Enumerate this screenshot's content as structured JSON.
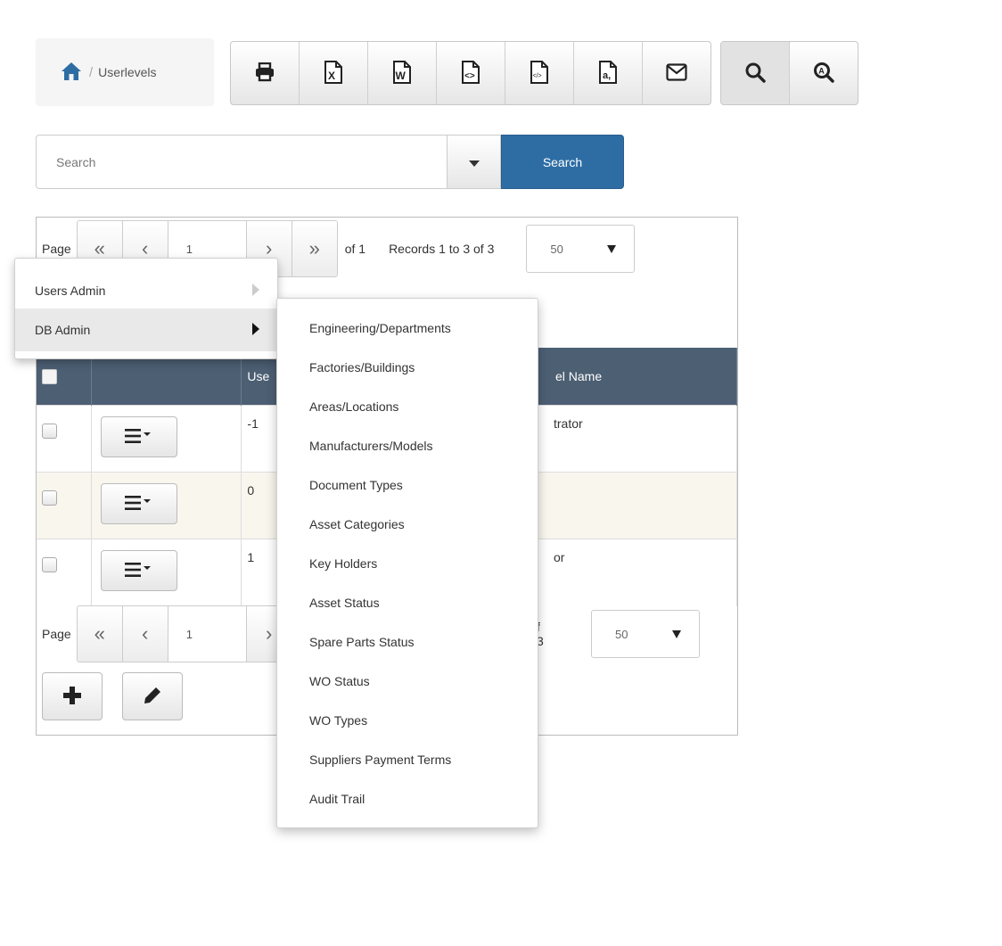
{
  "breadcrumb": {
    "current": "Userlevels",
    "separator": "/"
  },
  "toolbar": {
    "export_icons": [
      "printer-icon",
      "excel-icon",
      "word-icon",
      "html-icon",
      "xml-icon",
      "csv-icon",
      "email-icon"
    ],
    "search_icons": [
      "search-icon",
      "advanced-search-icon"
    ]
  },
  "search": {
    "placeholder": "Search",
    "button_label": "Search"
  },
  "pager_top": {
    "label": "Page",
    "current_page": "1",
    "of_text": "of 1",
    "records_text": "Records 1 to 3 of 3",
    "page_size": "50"
  },
  "pager_bottom": {
    "label": "Page",
    "current_page": "1",
    "records_fragment": "f 3",
    "page_size": "50"
  },
  "table": {
    "headers": [
      "Use",
      "el Name"
    ],
    "rows": [
      {
        "id": "-1",
        "name": "trator"
      },
      {
        "id": "0",
        "name": ""
      },
      {
        "id": "1",
        "name": "or"
      }
    ]
  },
  "menu": {
    "items": [
      {
        "label": "Users Admin"
      },
      {
        "label": "DB Admin"
      }
    ]
  },
  "submenu": {
    "items": [
      "Engineering/Departments",
      "Factories/Buildings",
      "Areas/Locations",
      "Manufacturers/Models",
      "Document Types",
      "Asset Categories",
      "Key Holders",
      "Asset Status",
      "Spare Parts Status",
      "WO Status",
      "WO Types",
      "Suppliers Payment Terms",
      "Audit Trail"
    ]
  },
  "colors": {
    "primary": "#2e6da4",
    "table_header": "#4c5f73",
    "home_icon": "#2e6da4",
    "alt_row": "#f9f6ee"
  }
}
